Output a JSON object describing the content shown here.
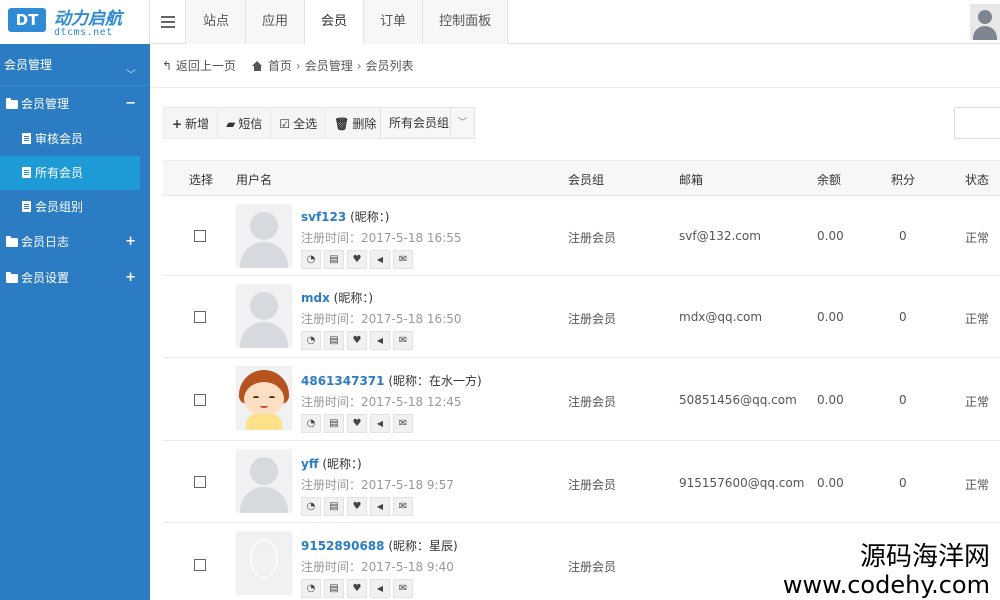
{
  "logo": {
    "badge": "DT",
    "name": "动力启航",
    "sub": "dtcms.net"
  },
  "topnav": [
    "站点",
    "应用",
    "会员",
    "订单",
    "控制面板"
  ],
  "topnav_active": 2,
  "sidebar": {
    "title": "会员管理",
    "groups": [
      {
        "label": "会员管理",
        "sign": "−",
        "items": [
          "审核会员",
          "所有会员",
          "会员组别"
        ]
      },
      {
        "label": "会员日志",
        "sign": "+"
      },
      {
        "label": "会员设置",
        "sign": "+"
      }
    ]
  },
  "breadcrumb": {
    "back": "返回上一页",
    "items": [
      "首页",
      "会员管理",
      "会员列表"
    ]
  },
  "toolbar": {
    "add": "新增",
    "sms": "短信",
    "select_all": "全选",
    "delete": "删除",
    "group_select": "所有会员组"
  },
  "table": {
    "headers": {
      "select": "选择",
      "username": "用户名",
      "group": "会员组",
      "email": "邮箱",
      "balance": "余额",
      "points": "积分",
      "status": "状态"
    },
    "rows": [
      {
        "username": "svf123",
        "nickname": "(昵称：)",
        "reg_time": "注册时间：2017-5-18 16:55",
        "group": "注册会员",
        "email": "svf@132.com",
        "balance": "0.00",
        "points": "0",
        "status": "正常"
      },
      {
        "username": "mdx",
        "nickname": "(昵称：)",
        "reg_time": "注册时间：2017-5-18 16:50",
        "group": "注册会员",
        "email": "mdx@qq.com",
        "balance": "0.00",
        "points": "0",
        "status": "正常"
      },
      {
        "username": "4861347371",
        "nickname": "(昵称：在水一方)",
        "reg_time": "注册时间：2017-5-18 12:45",
        "group": "注册会员",
        "email": "50851456@qq.com",
        "balance": "0.00",
        "points": "0",
        "status": "正常"
      },
      {
        "username": "yff",
        "nickname": "(昵称：)",
        "reg_time": "注册时间：2017-5-18 9:57",
        "group": "注册会员",
        "email": "915157600@qq.com",
        "balance": "0.00",
        "points": "0",
        "status": "正常"
      },
      {
        "username": "9152890688",
        "nickname": "(昵称：星辰)",
        "reg_time": "注册时间：2017-5-18 9:40",
        "group": "注册会员",
        "email": "",
        "balance": "",
        "points": "",
        "status": ""
      }
    ]
  },
  "watermark": {
    "line1": "源码海洋网",
    "line2": "www.codehy.com"
  }
}
